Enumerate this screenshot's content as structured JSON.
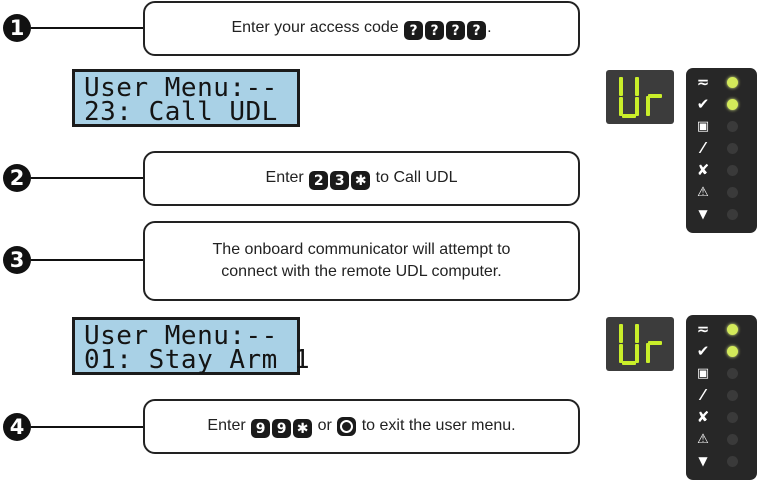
{
  "colors": {
    "lcd_background": "#a9d1e6",
    "led_on": "#d3ea5a",
    "led_off": "#3a3a3a",
    "segment": "#c9ee2a",
    "panel": "#272727"
  },
  "steps": [
    {
      "number": "1",
      "text_before": "Enter your access code",
      "keys": [
        "?",
        "?",
        "?",
        "?"
      ],
      "text_after": "."
    },
    {
      "number": "2",
      "text_before": "Enter",
      "keys": [
        "2",
        "3",
        "✱"
      ],
      "text_after": "to Call UDL"
    },
    {
      "number": "3",
      "text": "The onboard communicator will attempt to\nconnect with the remote UDL computer."
    },
    {
      "number": "4",
      "text_before": "Enter",
      "keys": [
        "9",
        "9",
        "✱"
      ],
      "text_middle": "or",
      "text_after": "to exit the user menu."
    }
  ],
  "lcd_screens": [
    {
      "line1": "User Menu:--",
      "line2": "23: Call UDL"
    },
    {
      "line1": "User Menu:--",
      "line2": "01: Stay Arm 1"
    }
  ],
  "segment_display": {
    "text": "Ur"
  },
  "status_panels": [
    {
      "leds": [
        {
          "icon": "ac-power-icon",
          "on": true
        },
        {
          "icon": "ready-check-icon",
          "on": true
        },
        {
          "icon": "armed-lock-icon",
          "on": false
        },
        {
          "icon": "bypass-icon",
          "on": false
        },
        {
          "icon": "trouble-x-icon",
          "on": false
        },
        {
          "icon": "warning-triangle-icon",
          "on": false
        },
        {
          "icon": "alarm-bell-icon",
          "on": false
        }
      ]
    },
    {
      "leds": [
        {
          "icon": "ac-power-icon",
          "on": true
        },
        {
          "icon": "ready-check-icon",
          "on": true
        },
        {
          "icon": "armed-lock-icon",
          "on": false
        },
        {
          "icon": "bypass-icon",
          "on": false
        },
        {
          "icon": "trouble-x-icon",
          "on": false
        },
        {
          "icon": "warning-triangle-icon",
          "on": false
        },
        {
          "icon": "alarm-bell-icon",
          "on": false
        }
      ]
    }
  ]
}
